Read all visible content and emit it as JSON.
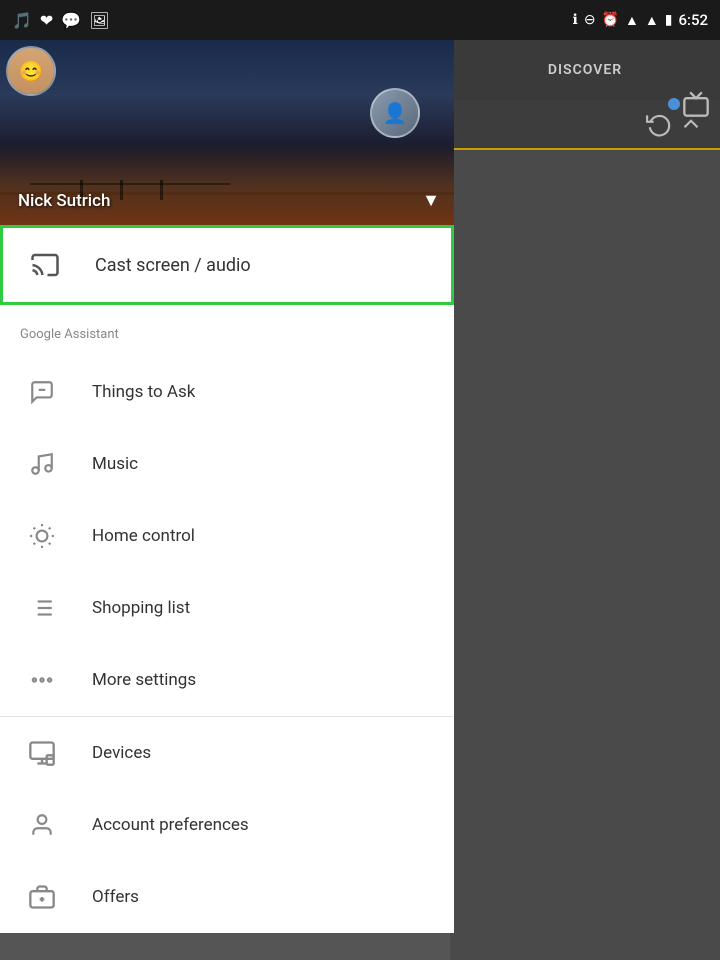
{
  "statusBar": {
    "time": "6:52",
    "icons": [
      "bluetooth",
      "minus-circle",
      "alarm",
      "wifi",
      "signal",
      "battery"
    ]
  },
  "rightPanel": {
    "title": "DISCOVER",
    "devicesIconLabel": "devices-icon"
  },
  "profileHeader": {
    "name": "Nick Sutrich",
    "dropdownIcon": "▾"
  },
  "castItem": {
    "label": "Cast screen / audio",
    "iconName": "cast-icon"
  },
  "googleAssistantSection": {
    "label": "Google Assistant",
    "items": [
      {
        "id": "things-to-ask",
        "label": "Things to Ask",
        "iconName": "chat-icon"
      },
      {
        "id": "music",
        "label": "Music",
        "iconName": "music-icon"
      },
      {
        "id": "home-control",
        "label": "Home control",
        "iconName": "lightbulb-icon"
      },
      {
        "id": "shopping-list",
        "label": "Shopping list",
        "iconName": "list-icon"
      },
      {
        "id": "more-settings",
        "label": "More settings",
        "iconName": "more-icon"
      }
    ]
  },
  "bottomSection": {
    "items": [
      {
        "id": "devices",
        "label": "Devices",
        "iconName": "devices-icon"
      },
      {
        "id": "account-preferences",
        "label": "Account preferences",
        "iconName": "account-icon"
      },
      {
        "id": "offers",
        "label": "Offers",
        "iconName": "offers-icon"
      }
    ]
  }
}
